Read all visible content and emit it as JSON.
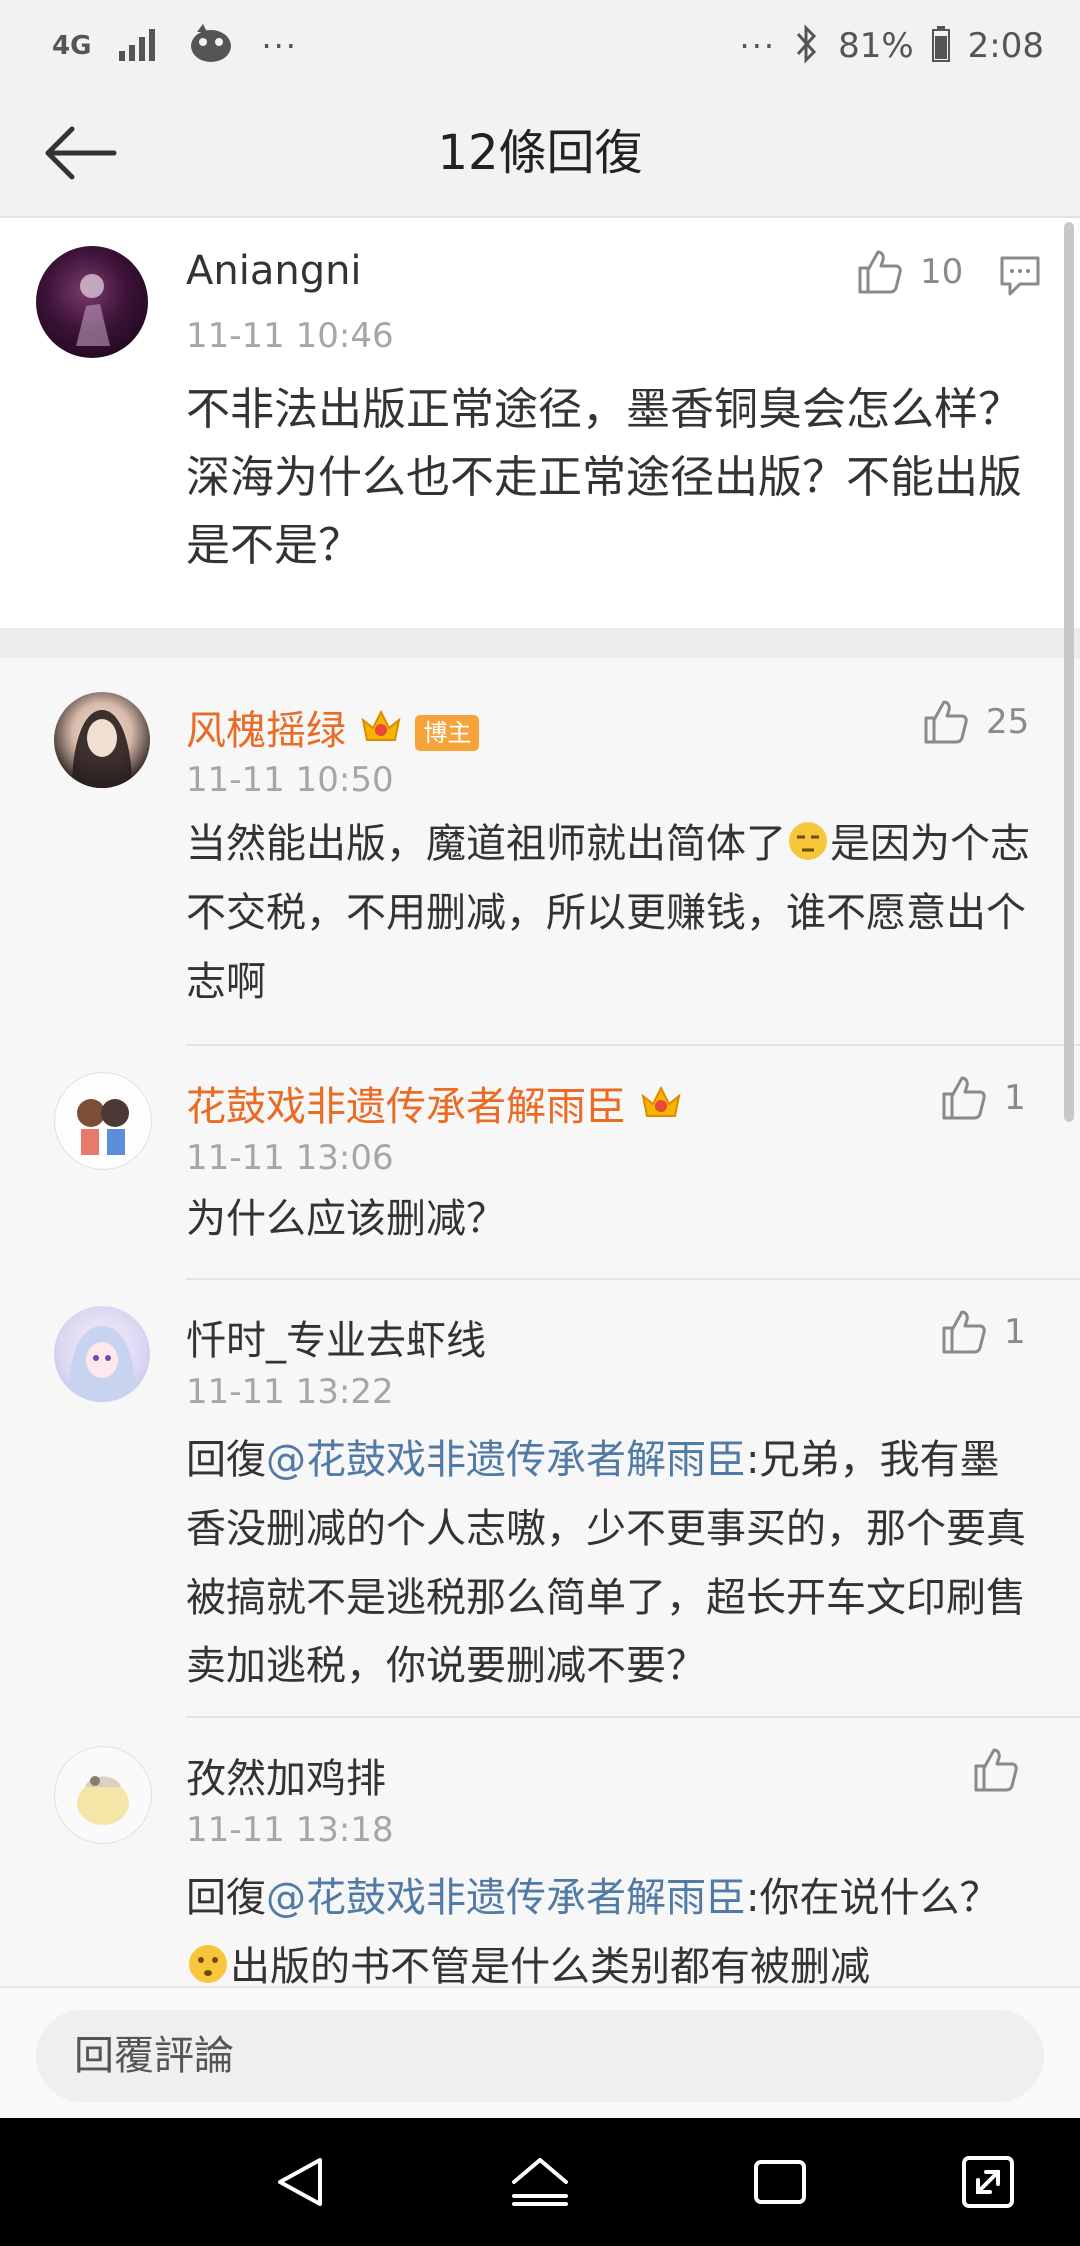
{
  "status_bar": {
    "network": "4G",
    "battery": "81%",
    "time": "2:08",
    "dots": "···",
    "icons": [
      "signal-icon",
      "game-app-icon",
      "bluetooth-icon",
      "battery-icon"
    ]
  },
  "header": {
    "title": "12條回復"
  },
  "main_comment": {
    "author": "Aniangni",
    "time": "11-11 10:46",
    "likes": "10",
    "text": "不非法出版正常途径，墨香铜臭会怎么样？深海为什么也不走正常途径出版？不能出版是不是？"
  },
  "replies": [
    {
      "author": "风槐摇绿",
      "badge": "博主",
      "time": "11-11 10:50",
      "likes": "25",
      "text_before": "当然能出版，魔道祖师就出简体了",
      "text_after": "是因为个志不交税，不用删减，所以更赚钱，谁不愿意出个志啊"
    },
    {
      "author": "花鼓戏非遗传承者解雨臣",
      "time": "11-11 13:06",
      "likes": "1",
      "text": "为什么应该删减？"
    },
    {
      "author": "忏时_专业去虾线",
      "time": "11-11 13:22",
      "likes": "1",
      "reply_prefix": "回復",
      "mention": "@花鼓戏非遗传承者解雨臣",
      "text": ":兄弟，我有墨香没删减的个人志嗷，少不更事买的，那个要真被搞就不是逃税那么简单了，超长开车文印刷售卖加逃税，你说要删减不要？"
    },
    {
      "author": "孜然加鸡排",
      "time": "11-11 13:18",
      "reply_prefix": "回復",
      "mention": "@花鼓戏非遗传承者解雨臣",
      "text_before": ":你在说什么？",
      "text_after": "出版的书不管是什么类别都有被删减"
    }
  ],
  "input": {
    "placeholder": "回覆評論"
  },
  "colors": {
    "accent_orange": "#ea6b24",
    "mention_blue": "#527aa6",
    "badge_orange": "#f6a33a"
  }
}
